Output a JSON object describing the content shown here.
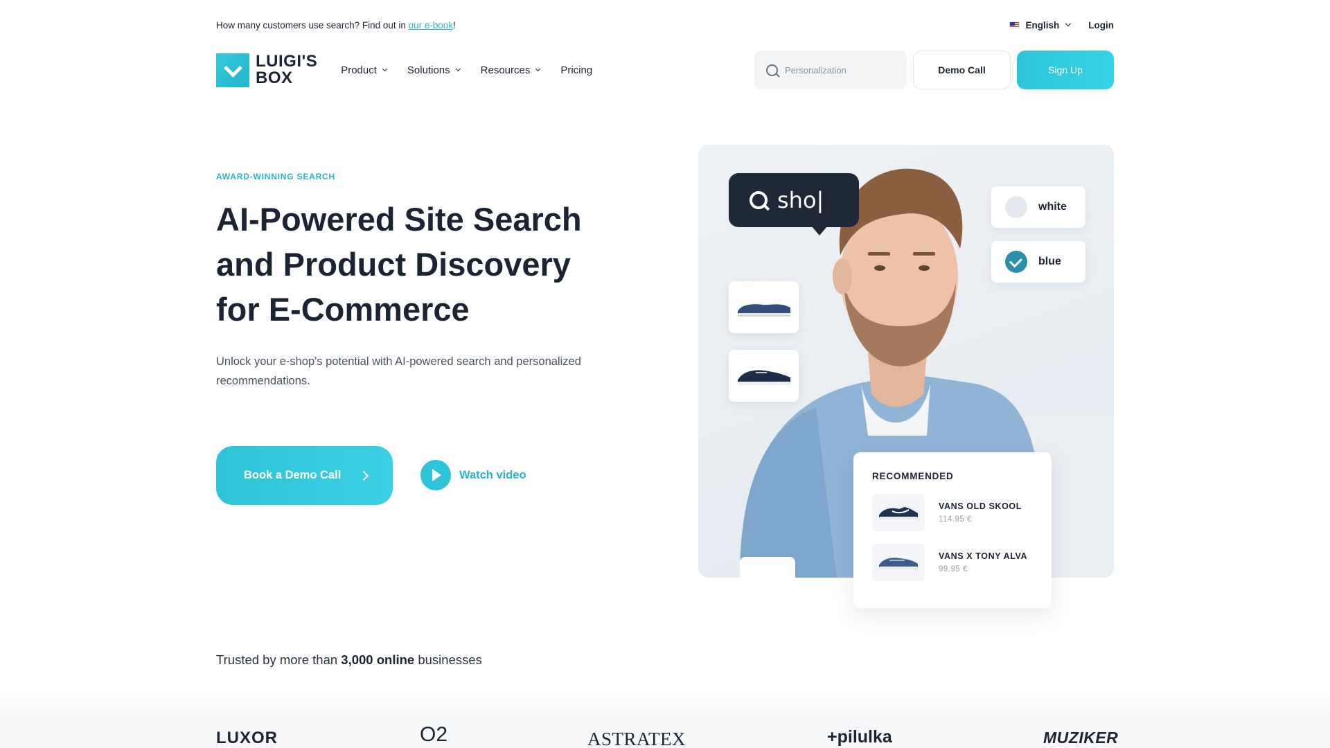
{
  "promo": {
    "text": "How many customers use search? Find out in ",
    "link": "our e-book",
    "suffix": "!"
  },
  "topbar": {
    "language": "English",
    "login": "Login"
  },
  "logo": {
    "line1": "LUIGI'S",
    "line2": "BOX"
  },
  "nav": {
    "items": [
      {
        "label": "Product",
        "dropdown": true
      },
      {
        "label": "Solutions",
        "dropdown": true
      },
      {
        "label": "Resources",
        "dropdown": true
      },
      {
        "label": "Pricing",
        "dropdown": false
      }
    ],
    "search_placeholder": "Personalization",
    "demo_call": "Demo Call",
    "sign_up": "Sign Up"
  },
  "hero": {
    "eyebrow": "AWARD-WINNING SEARCH",
    "headline_l1": "AI-Powered Site Search",
    "headline_l2": "and Product Discovery",
    "headline_l3": "for E-Commerce",
    "subtitle": "Unlock your e-shop's potential with AI-powered search and personalized recommendations.",
    "cta_primary": "Book a Demo Call",
    "cta_video": "Watch video"
  },
  "visual": {
    "search_query": "sho|",
    "filters": [
      {
        "label": "white",
        "checked": false
      },
      {
        "label": "blue",
        "checked": true
      }
    ],
    "recommended": {
      "title": "RECOMMENDED",
      "items": [
        {
          "name": "VANS OLD SKOOL",
          "price": "114.95 €"
        },
        {
          "name": "VANS X TONY ALVA",
          "price": "99.95 €"
        }
      ]
    }
  },
  "trusted": {
    "prefix": "Trusted by more than ",
    "bold": "3,000 online",
    "suffix": " businesses"
  },
  "brands": [
    "LUXOR",
    "O2",
    "ASTRATEX",
    "+pilulka",
    "MUZIKER"
  ],
  "colors": {
    "accent": "#2ec4d8",
    "accent_text": "#2bb3c9",
    "dark": "#1c2433",
    "bubble": "#1e2836"
  }
}
